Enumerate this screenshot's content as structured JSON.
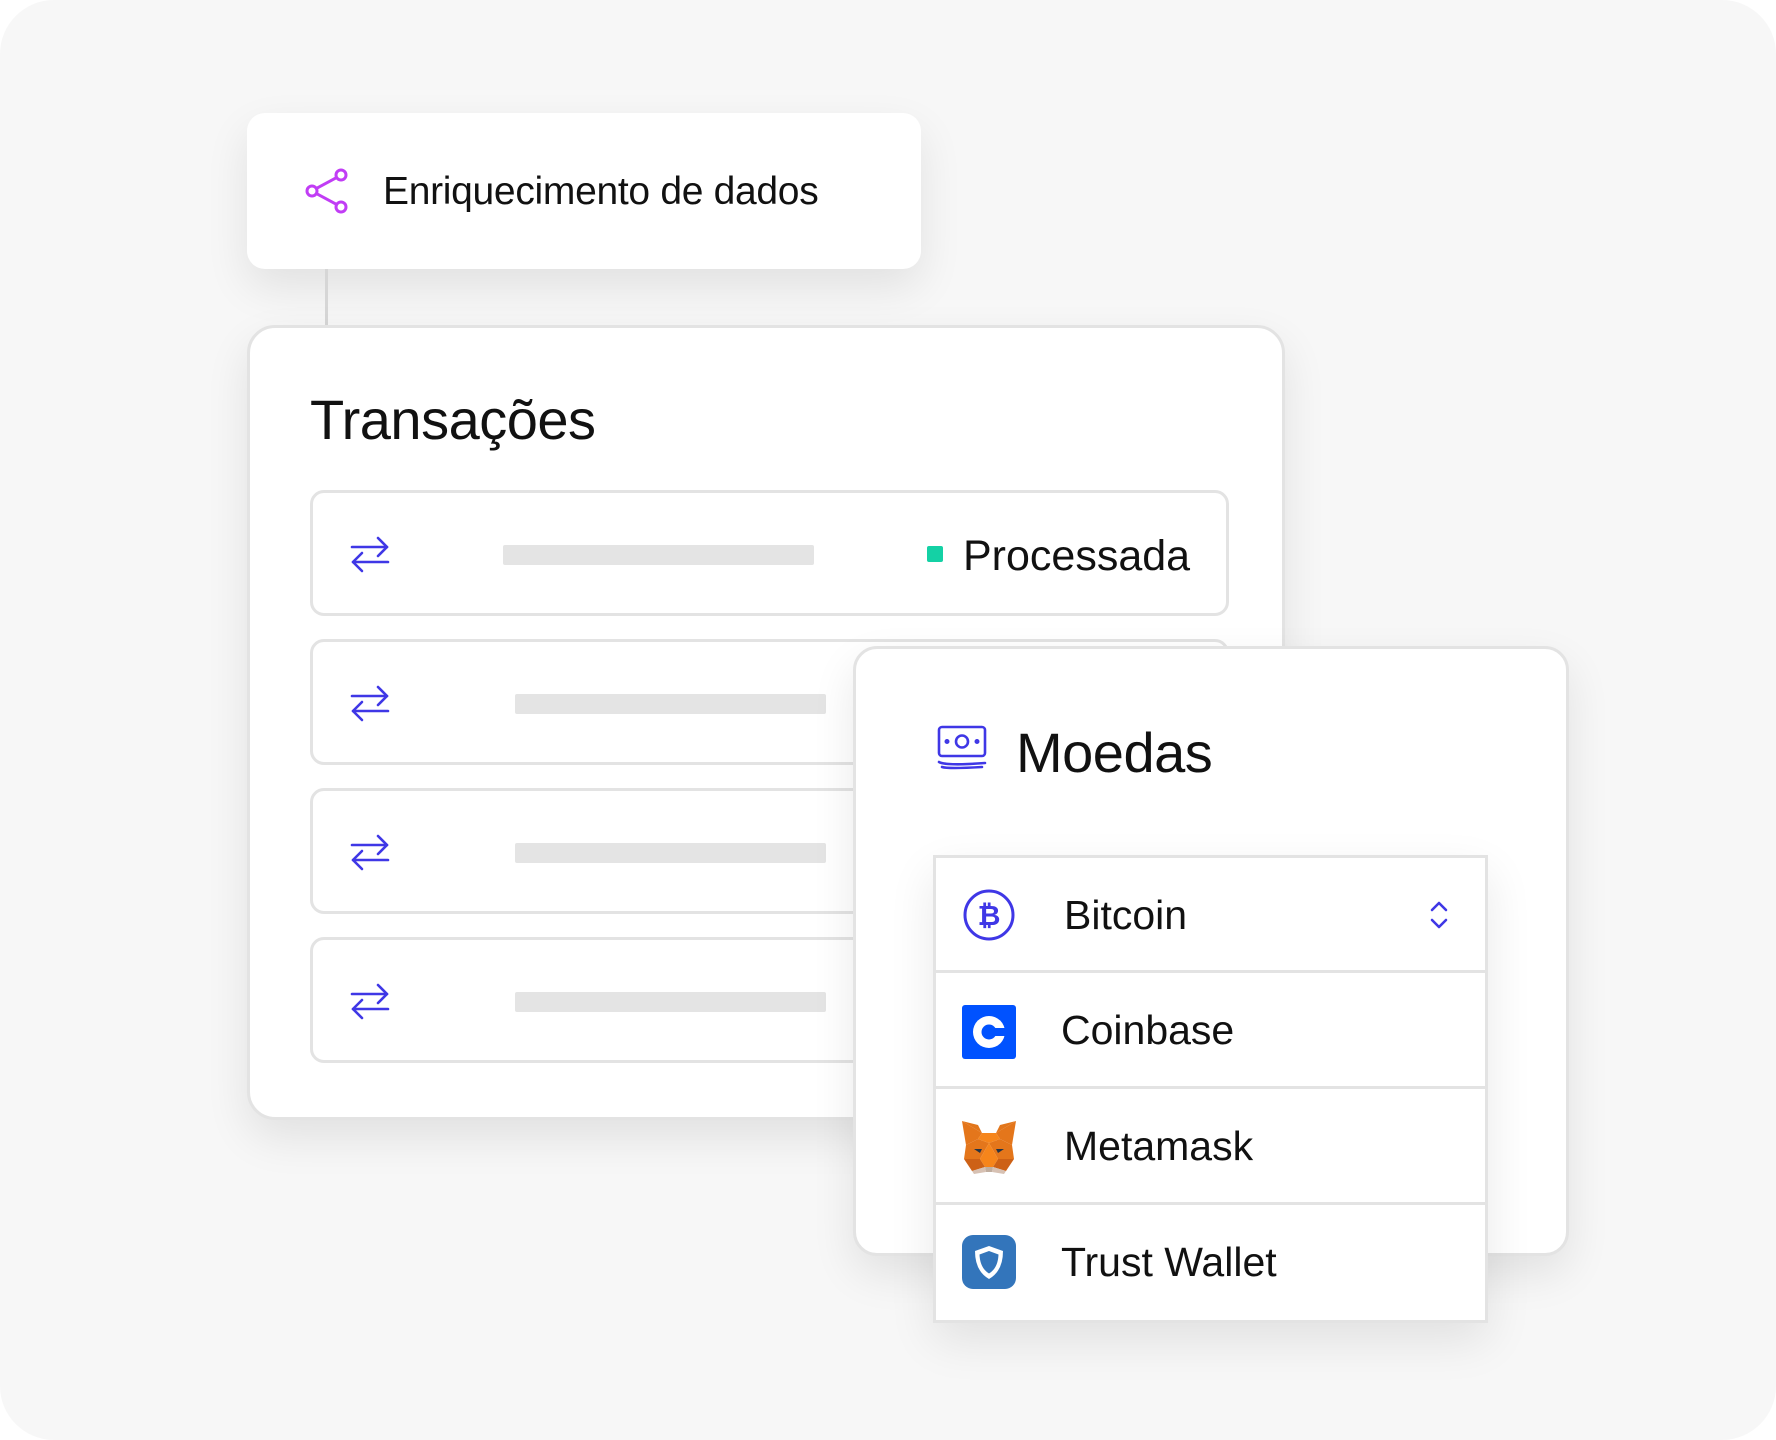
{
  "enrichment": {
    "title": "Enriquecimento de dados",
    "icon": "share-icon",
    "icon_color": "#c13df5"
  },
  "transactions": {
    "title": "Transações",
    "rows": [
      {
        "icon": "swap-arrows-icon",
        "status": "Processada",
        "status_color": "#14d1a5"
      },
      {
        "icon": "swap-arrows-icon"
      },
      {
        "icon": "swap-arrows-icon"
      },
      {
        "icon": "swap-arrows-icon"
      }
    ],
    "accent_color": "#3f37e6"
  },
  "currencies": {
    "title": "Moedas",
    "icon": "banknote-icon",
    "options": [
      {
        "label": "Bitcoin",
        "icon": "bitcoin-icon",
        "selected": true
      },
      {
        "label": "Coinbase",
        "icon": "coinbase-logo"
      },
      {
        "label": "Metamask",
        "icon": "metamask-logo"
      },
      {
        "label": "Trust Wallet",
        "icon": "trust-wallet-logo"
      }
    ]
  }
}
